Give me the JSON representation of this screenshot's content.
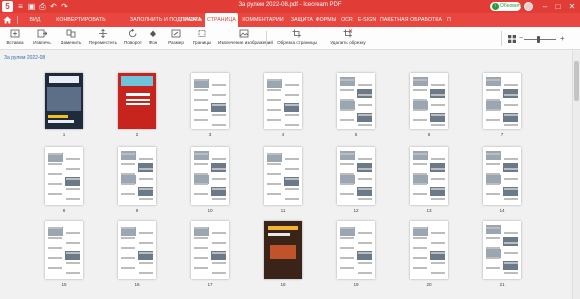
{
  "window": {
    "title": "За рулем 2022-08.pdf - Icecream PDF",
    "app_logo": "5",
    "update_label": "Обновить",
    "accent": "#e23c37"
  },
  "titlebar_icons": [
    "menu-icon",
    "save-icon",
    "print-icon",
    "undo-icon",
    "redo-icon"
  ],
  "menu": {
    "tabs": [
      {
        "label": "ВИД"
      },
      {
        "label": "КОНВЕРТИРОВАТЬ"
      },
      {
        "label": "ЗАПОЛНИТЬ И ПОДПИСАТЬ"
      },
      {
        "label": "ПРАВКА"
      },
      {
        "label": "СТРАНИЦА"
      },
      {
        "label": "КОММЕНТАРИИ"
      },
      {
        "label": "ЗАЩИТА"
      },
      {
        "label": "ФОРМЫ"
      },
      {
        "label": "OCR"
      },
      {
        "label": "E-SIGN"
      },
      {
        "label": "ПАКЕТНАЯ ОБРАБОТКА"
      },
      {
        "label": "П"
      }
    ],
    "active": "СТРАНИЦА"
  },
  "ribbon": {
    "items": [
      {
        "label": "Вставка",
        "icon": "insert-icon"
      },
      {
        "label": "Извлечь",
        "icon": "extract-icon"
      },
      {
        "label": "Заменить",
        "icon": "replace-icon"
      },
      {
        "label": "Переместить",
        "icon": "move-icon"
      },
      {
        "label": "Поворот",
        "icon": "rotate-icon"
      },
      {
        "label": "Фон",
        "icon": "background-icon"
      },
      {
        "label": "Размер",
        "icon": "resize-icon"
      },
      {
        "label": "Границы",
        "icon": "crop-icon"
      },
      {
        "label": "Извлечение изображений",
        "icon": "extract-images-icon"
      },
      {
        "label": "Обрезка страницы",
        "icon": "page-crop-icon"
      },
      {
        "label": "Удалить обрезку",
        "icon": "remove-crop-icon"
      }
    ]
  },
  "document": {
    "label": "За рулем 2022-08"
  },
  "pages": [
    {
      "num": "1",
      "style": "cover-dark"
    },
    {
      "num": "2",
      "style": "cover-red"
    },
    {
      "num": "3",
      "style": "text"
    },
    {
      "num": "4",
      "style": "text"
    },
    {
      "num": "5",
      "style": "photo"
    },
    {
      "num": "6",
      "style": "photo"
    },
    {
      "num": "7",
      "style": "photo"
    },
    {
      "num": "8",
      "style": "text"
    },
    {
      "num": "9",
      "style": "photo"
    },
    {
      "num": "10",
      "style": "photo"
    },
    {
      "num": "11",
      "style": "text"
    },
    {
      "num": "12",
      "style": "photo"
    },
    {
      "num": "13",
      "style": "photo"
    },
    {
      "num": "14",
      "style": "photo"
    },
    {
      "num": "15",
      "style": "text"
    },
    {
      "num": "16",
      "style": "text"
    },
    {
      "num": "17",
      "style": "text"
    },
    {
      "num": "18",
      "style": "dark-photo"
    },
    {
      "num": "19",
      "style": "text"
    },
    {
      "num": "20",
      "style": "text"
    },
    {
      "num": "21",
      "style": "photo"
    }
  ]
}
